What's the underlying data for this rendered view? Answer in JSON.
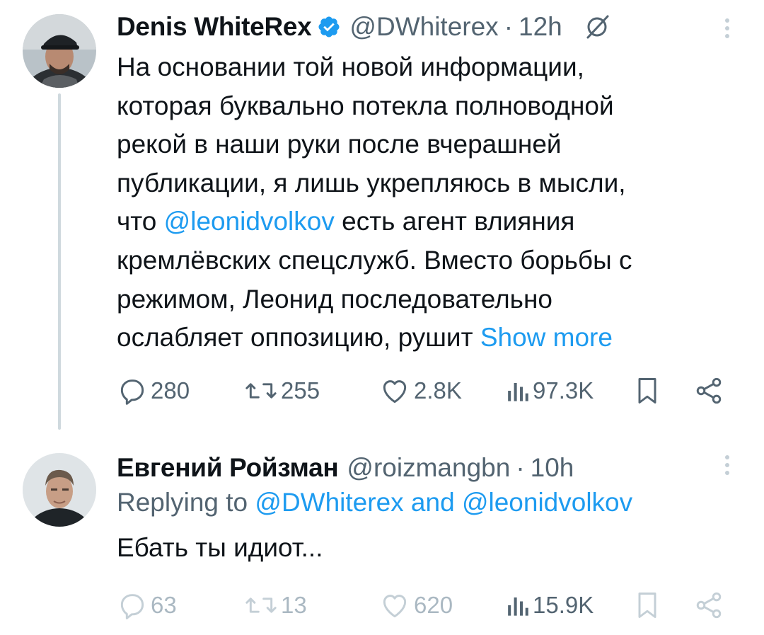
{
  "tweets": [
    {
      "author": {
        "name": "Denis WhiteRex",
        "handle": "@DWhiterex",
        "verified": true
      },
      "time": "12h",
      "separator": "·",
      "text_lines": {
        "l1": "На основании той новой информации,",
        "l2": "которая буквально потекла полноводной",
        "l3": "рекой в наши руки после вчерашней",
        "l4": "публикации, я лишь укрепляюсь в мысли,",
        "l5_pre": "что ",
        "l5_mention": "@leonidvolkov",
        "l5_post": " есть агент влияния",
        "l6": "кремлёвских спецслужб. Вместо борьбы с",
        "l7": "режимом, Леонид последовательно",
        "l8": "ослабляет оппозицию, рушит "
      },
      "show_more": "Show more",
      "stats": {
        "replies": "280",
        "reposts": "255",
        "likes": "2.8K",
        "views": "97.3K"
      },
      "icons": [
        "verified-badge-icon",
        "grok-icon",
        "more-icon",
        "reply-icon",
        "repost-icon",
        "like-icon",
        "views-icon",
        "bookmark-icon",
        "share-icon"
      ]
    },
    {
      "author": {
        "name": "Евгений Ройзман",
        "handle": "@roizmangbn",
        "verified": false
      },
      "time": "10h",
      "separator": "·",
      "replying": {
        "prefix": "Replying to ",
        "mention1": "@DWhiterex",
        "and": " and ",
        "mention2": "@leonidvolkov"
      },
      "text": "Ебать ты идиот...",
      "stats": {
        "replies": "63",
        "reposts": "13",
        "likes": "620",
        "views": "15.9K"
      }
    }
  ],
  "colors": {
    "text": "#0f1419",
    "secondary": "#536471",
    "link": "#1d9bf0",
    "thread_line": "#cfd9de",
    "verified": "#1d9bf0"
  }
}
